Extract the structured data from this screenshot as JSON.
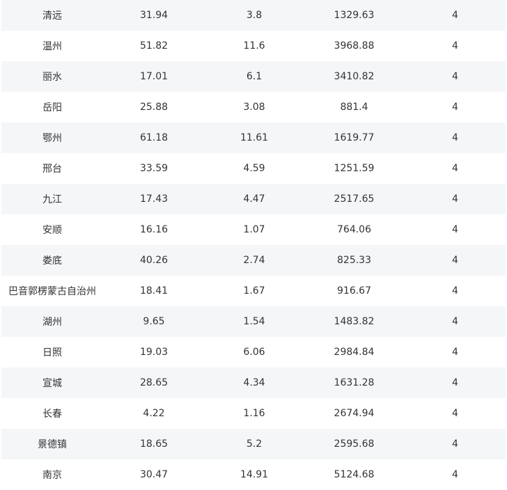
{
  "table": {
    "rows": [
      [
        "清远",
        "31.94",
        "3.8",
        "1329.63",
        "4"
      ],
      [
        "温州",
        "51.82",
        "11.6",
        "3968.88",
        "4"
      ],
      [
        "丽水",
        "17.01",
        "6.1",
        "3410.82",
        "4"
      ],
      [
        "岳阳",
        "25.88",
        "3.08",
        "881.4",
        "4"
      ],
      [
        "鄂州",
        "61.18",
        "11.61",
        "1619.77",
        "4"
      ],
      [
        "邢台",
        "33.59",
        "4.59",
        "1251.59",
        "4"
      ],
      [
        "九江",
        "17.43",
        "4.47",
        "2517.65",
        "4"
      ],
      [
        "安顺",
        "16.16",
        "1.07",
        "764.06",
        "4"
      ],
      [
        "娄底",
        "40.26",
        "2.74",
        "825.33",
        "4"
      ],
      [
        "巴音郭楞蒙古自治州",
        "18.41",
        "1.67",
        "916.67",
        "4"
      ],
      [
        "湖州",
        "9.65",
        "1.54",
        "1483.82",
        "4"
      ],
      [
        "日照",
        "19.03",
        "6.06",
        "2984.84",
        "4"
      ],
      [
        "宣城",
        "28.65",
        "4.34",
        "1631.28",
        "4"
      ],
      [
        "长春",
        "4.22",
        "1.16",
        "2674.94",
        "4"
      ],
      [
        "景德镇",
        "18.65",
        "5.2",
        "2595.68",
        "4"
      ],
      [
        "南京",
        "30.47",
        "14.91",
        "5124.68",
        "4"
      ]
    ]
  },
  "colors": {
    "stripe": "#f4f6f8",
    "text": "#333333"
  }
}
